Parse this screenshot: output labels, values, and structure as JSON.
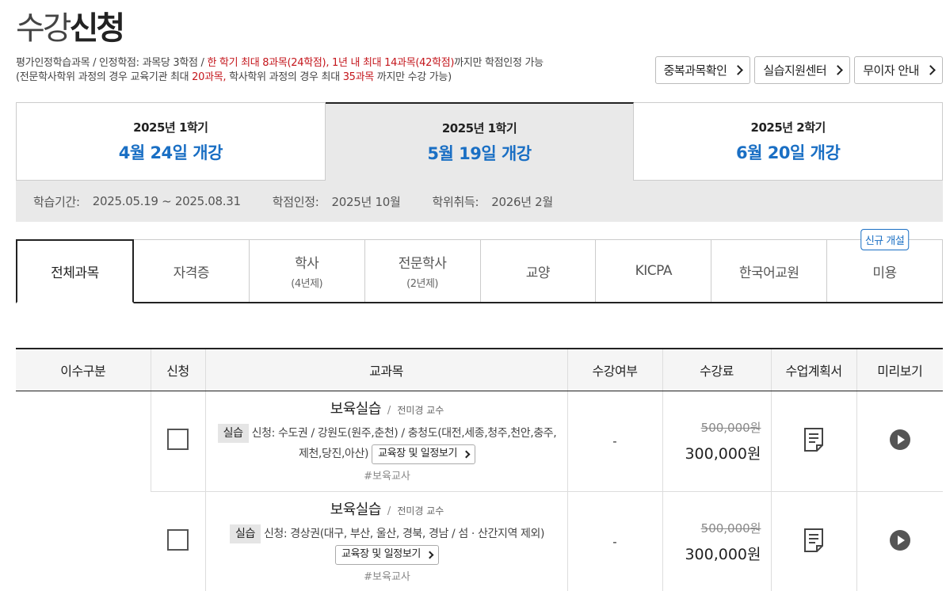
{
  "page": {
    "title_light": "수강",
    "title_bold": "신청"
  },
  "notice": {
    "l1_a": "평가인정학습과목 / 인정학점: 과목당 3학점 / ",
    "l1_b": "한 학기 최대 8과목(24학점), 1년 내 최대 14과목(42학점)",
    "l1_c": "까지만 학점인정 가능",
    "l2_a": "(전문학사학위 과정의 경우 교육기관 최대 ",
    "l2_b": "20과목,",
    "l2_c": " 학사학위 과정의 경우 최대 ",
    "l2_d": "35과목",
    "l2_e": " 까지만 수강 가능)"
  },
  "top_buttons": [
    {
      "label": "중복과목확인"
    },
    {
      "label": "실습지원센터"
    },
    {
      "label": "무이자 안내"
    }
  ],
  "semester_tabs": [
    {
      "year": "2025년 1학기",
      "open": "4월 24일 개강",
      "active": false
    },
    {
      "year": "2025년 1학기",
      "open": "5월 19일 개강",
      "active": true
    },
    {
      "year": "2025년 2학기",
      "open": "6월 20일 개강",
      "active": false
    }
  ],
  "semester_info": {
    "period_label": "학습기간:",
    "period_value": "2025.05.19 ~ 2025.08.31",
    "credit_label": "학점인정:",
    "credit_value": "2025년 10월",
    "degree_label": "학위취득:",
    "degree_value": "2026년 2월"
  },
  "category_tabs": [
    {
      "label": "전체과목",
      "sub": "",
      "active": true
    },
    {
      "label": "자격증",
      "sub": ""
    },
    {
      "label": "학사",
      "sub": "(4년제)"
    },
    {
      "label": "전문학사",
      "sub": "(2년제)"
    },
    {
      "label": "교양",
      "sub": ""
    },
    {
      "label": "KICPA",
      "sub": ""
    },
    {
      "label": "한국어교원",
      "sub": ""
    },
    {
      "label": "미용",
      "sub": "",
      "badge": "신규 개설"
    }
  ],
  "table": {
    "headers": [
      "이수구분",
      "신청",
      "교과목",
      "수강여부",
      "수강료",
      "수업계획서",
      "미리보기"
    ],
    "rows": [
      {
        "name": "보육실습",
        "professor": "전미경 교수",
        "tag": "실습",
        "desc": "신청: 수도권 / 강원도(원주,춘천) / 충청도(대전,세종,청주,천안,충주,제천,당진,아산)",
        "schedule_btn": "교육장 및 일정보기",
        "hashtag": "#보육교사",
        "status": "-",
        "orig_price": "500,000원",
        "sale_price": "300,000원"
      },
      {
        "name": "보육실습",
        "professor": "전미경 교수",
        "tag": "실습",
        "desc": "신청: 경상권(대구, 부산, 울산, 경북, 경남 / 섬 · 산간지역 제외)",
        "schedule_btn": "교육장 및 일정보기",
        "hashtag": "#보육교사",
        "status": "-",
        "orig_price": "500,000원",
        "sale_price": "300,000원"
      }
    ]
  }
}
